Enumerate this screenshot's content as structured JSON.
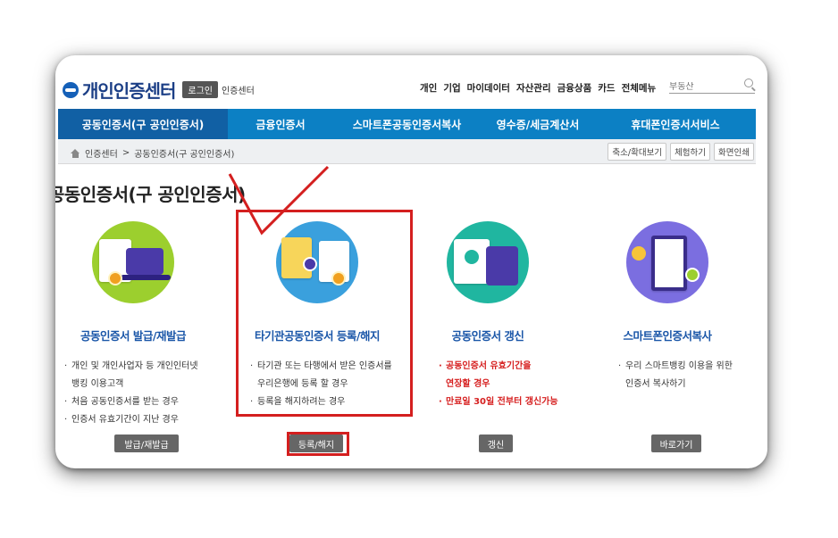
{
  "header": {
    "logo_text": "개인인증센터",
    "login_label": "로그인",
    "logo_sub": "인증센터",
    "nav": [
      "개인",
      "기업",
      "마이데이터",
      "자산관리",
      "금융상품",
      "카드",
      "전체메뉴"
    ],
    "search_placeholder": "부동산"
  },
  "tabs": [
    {
      "label": "공동인증서(구 공인인증서)",
      "active": true
    },
    {
      "label": "금융인증서",
      "active": false
    },
    {
      "label": "스마트폰공동인증서복사",
      "active": false
    },
    {
      "label": "영수증/세금계산서",
      "active": false
    },
    {
      "label": "휴대폰인증서서비스",
      "active": false
    }
  ],
  "breadcrumb": {
    "items": [
      "인증센터",
      "공동인증서(구 공인인증서)"
    ],
    "separator": ">",
    "buttons": [
      "축소/확대보기",
      "체험하기",
      "화면인쇄"
    ]
  },
  "page_title": "공동인증서(구 공인인증서)",
  "items": [
    {
      "title": "공동인증서 발급/재발급",
      "bullets": [
        "개인 및 개인사업자 등 개인인터넷",
        "뱅킹 이용고객",
        "처음 공동인증서를 받는 경우",
        "인증서 유효기간이 지난 경우"
      ],
      "action": "발급/재발급",
      "icon": "certificate-laptop-icon"
    },
    {
      "title": "타기관공동인증서 등록/해지",
      "bullets": [
        "타기관 또는 타행에서 받은 인증서를",
        "우리은행에 등록 할 경우",
        "등록을 해지하려는 경우"
      ],
      "action": "등록/해지",
      "icon": "certificate-transfer-icon"
    },
    {
      "title": "공동인증서 갱신",
      "bullets": [
        "공동인증서 유효기간을",
        "연장할 경우",
        "만료일 30일 전부터 갱신가능"
      ],
      "action": "갱신",
      "icon": "certificate-renew-icon"
    },
    {
      "title": "스마트폰인증서복사",
      "bullets": [
        "우리 스마트뱅킹 이용을 위한",
        "인증서 복사하기"
      ],
      "action": "바로가기",
      "icon": "smartphone-key-icon"
    }
  ],
  "colors": {
    "tab_bar": "#0c80c4",
    "tab_active": "#1160a4",
    "item_title": "#1a56a8",
    "highlight_red": "#d41f1f",
    "warning_text": "#d62020"
  }
}
